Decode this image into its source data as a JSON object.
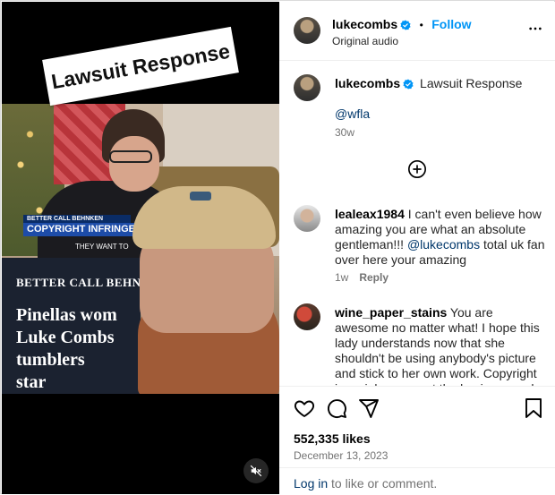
{
  "video": {
    "sticker_text": "Lawsuit Response",
    "news": {
      "banner_top": "BETTER CALL BEHNKEN",
      "banner": "COPYRIGHT INFRINGEM",
      "ticker": "THEY WANT TO",
      "panel_head": "BETTER CALL BEHN",
      "panel_lines": [
        "Pinellas wom",
        "Luke Combs",
        "tumblers",
        "star"
      ]
    }
  },
  "header": {
    "username": "lukecombs",
    "separator": "•",
    "follow_label": "Follow",
    "subtitle": "Original audio"
  },
  "caption": {
    "username": "lukecombs",
    "text": "Lawsuit Response",
    "mention": "@wfla",
    "time": "30w"
  },
  "comments": [
    {
      "username": "lealeax1984",
      "text_before": "I can't even believe how amazing you are what an absolute gentleman!!!",
      "mention": "@lukecombs",
      "text_after": "total uk fan over here your amazing",
      "time": "1w",
      "reply_label": "Reply"
    },
    {
      "username": "wine_paper_stains",
      "text": "You are awesome no matter what! I hope this lady understands now that she shouldn't be using anybody's picture and stick to her own work. Copyright is no joke, respect the business and hope she has learned a"
    }
  ],
  "footer": {
    "likes": "552,335 likes",
    "date": "December 13, 2023",
    "login_link": "Log in",
    "login_text": "to like or comment."
  },
  "colors": {
    "accent": "#0095f6",
    "verified": "#0095f6",
    "link": "#00376b",
    "muted": "#737373"
  }
}
